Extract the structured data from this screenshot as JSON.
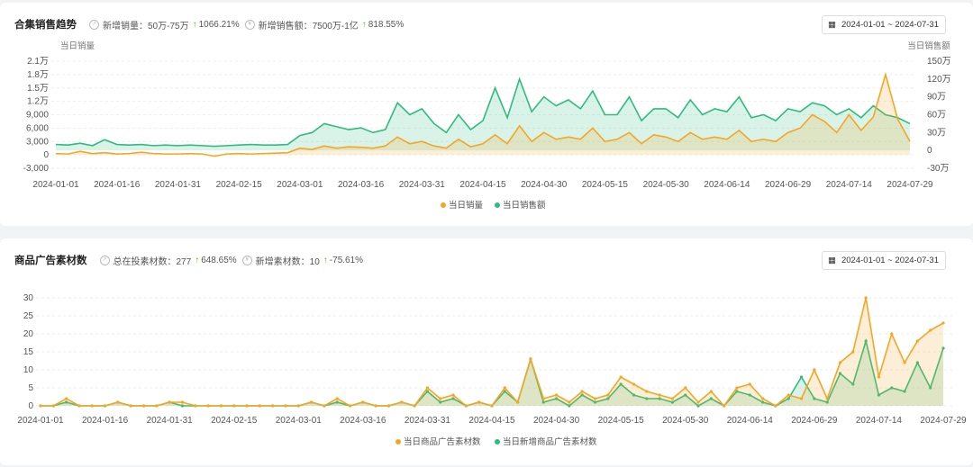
{
  "panel1": {
    "title": "合集销售趋势",
    "m1_label": "新增销量：50万-75万",
    "m1_change": "1066.21%",
    "m2_label": "新增销售额：7500万-1亿",
    "m2_change": "818.55%",
    "date_range": "2024-01-01 ~ 2024-07-31"
  },
  "panel2": {
    "title": "商品广告素材数",
    "m1_label": "总在投素材数：277",
    "m1_change": "648.65%",
    "m2_label": "新增素材数：10",
    "m2_change": "-75.61%",
    "date_range": "2024-01-01 ~ 2024-07-31"
  },
  "colors": {
    "orange": "#f5a623",
    "green": "#2dbd7e",
    "up": "#52c41a"
  },
  "chart_data": [
    {
      "type": "line",
      "start": "2024-01-01",
      "step_days": 3,
      "xticks": [
        "2024-01-01",
        "2024-01-16",
        "2024-01-31",
        "2024-02-15",
        "2024-03-01",
        "2024-03-16",
        "2024-03-31",
        "2024-04-15",
        "2024-04-30",
        "2024-05-15",
        "2024-05-30",
        "2024-06-14",
        "2024-06-29",
        "2024-07-14",
        "2024-07-29"
      ],
      "ylabel": "当日销量",
      "y2label": "当日销售额",
      "yticks": [
        "-3,000",
        "0",
        "3,000",
        "6,000",
        "9,000",
        "1.2万",
        "1.5万",
        "1.8万",
        "2.1万"
      ],
      "ylim": [
        -3000,
        21000
      ],
      "y2ticks": [
        "-30万",
        "0",
        "30万",
        "60万",
        "90万",
        "120万",
        "150万"
      ],
      "y2lim": [
        -30,
        150
      ],
      "series": [
        {
          "name": "当日销量",
          "axis": "left",
          "color": "#f5a623",
          "values": [
            300,
            200,
            800,
            300,
            500,
            200,
            300,
            600,
            300,
            200,
            200,
            300,
            200,
            -300,
            200,
            300,
            200,
            300,
            400,
            500,
            1500,
            1200,
            2000,
            1500,
            1800,
            1700,
            1500,
            2000,
            4000,
            2500,
            3000,
            2000,
            1500,
            3500,
            1800,
            2500,
            4500,
            2500,
            6500,
            3000,
            5000,
            3500,
            4000,
            3500,
            6000,
            3000,
            3500,
            5000,
            2500,
            4500,
            4000,
            3000,
            5000,
            3500,
            4000,
            3500,
            5500,
            3000,
            3500,
            3000,
            5000,
            6000,
            9000,
            7500,
            5000,
            9000,
            5500,
            8500,
            18000,
            8000,
            3000
          ]
        },
        {
          "name": "当日销售额",
          "axis": "right",
          "color": "#2dbd7e",
          "values": [
            10,
            9,
            12,
            8,
            18,
            10,
            9,
            10,
            8,
            9,
            8,
            9,
            8,
            7,
            8,
            9,
            10,
            9,
            9,
            10,
            25,
            30,
            45,
            40,
            35,
            38,
            30,
            35,
            80,
            60,
            70,
            45,
            30,
            60,
            35,
            50,
            105,
            55,
            120,
            65,
            90,
            75,
            85,
            70,
            100,
            60,
            60,
            90,
            50,
            70,
            70,
            55,
            85,
            60,
            70,
            65,
            90,
            55,
            60,
            50,
            70,
            65,
            80,
            75,
            60,
            70,
            55,
            75,
            60,
            55,
            45
          ]
        }
      ]
    },
    {
      "type": "line",
      "start": "2024-01-01",
      "step_days": 3,
      "xticks": [
        "2024-01-01",
        "2024-01-16",
        "2024-01-31",
        "2024-02-15",
        "2024-03-01",
        "2024-03-16",
        "2024-03-31",
        "2024-04-15",
        "2024-04-30",
        "2024-05-15",
        "2024-05-30",
        "2024-06-14",
        "2024-06-29",
        "2024-07-14",
        "2024-07-29"
      ],
      "yticks": [
        "0",
        "5",
        "10",
        "15",
        "20",
        "25",
        "30"
      ],
      "ylim": [
        0,
        30
      ],
      "series": [
        {
          "name": "当日商品广告素材数",
          "color": "#f5a623",
          "values": [
            0,
            0,
            2,
            0,
            0,
            0,
            1,
            0,
            0,
            0,
            1,
            1,
            0,
            0,
            0,
            0,
            0,
            0,
            0,
            0,
            0,
            1,
            0,
            2,
            0,
            1,
            0,
            0,
            1,
            0,
            5,
            2,
            3,
            0,
            1,
            0,
            5,
            1,
            13,
            2,
            3,
            1,
            4,
            2,
            3,
            8,
            6,
            4,
            3,
            2,
            5,
            1,
            4,
            0,
            5,
            6,
            2,
            0,
            3,
            2,
            10,
            2,
            12,
            15,
            30,
            8,
            20,
            12,
            18,
            21,
            23
          ]
        },
        {
          "name": "当日新增商品广告素材数",
          "color": "#2dbd7e",
          "values": [
            0,
            0,
            1,
            0,
            0,
            0,
            1,
            0,
            0,
            0,
            1,
            0,
            0,
            0,
            0,
            0,
            0,
            0,
            0,
            0,
            0,
            1,
            0,
            1,
            0,
            1,
            0,
            0,
            1,
            0,
            4,
            1,
            2,
            0,
            1,
            0,
            4,
            1,
            13,
            1,
            2,
            0,
            3,
            1,
            2,
            6,
            3,
            2,
            2,
            1,
            3,
            0,
            2,
            0,
            4,
            3,
            1,
            0,
            2,
            8,
            2,
            1,
            9,
            6,
            18,
            3,
            5,
            4,
            12,
            5,
            16
          ]
        }
      ]
    }
  ]
}
